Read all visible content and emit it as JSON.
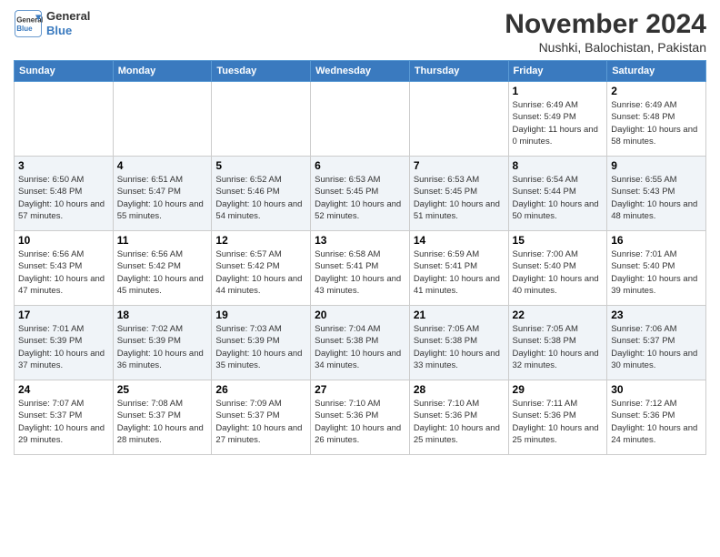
{
  "logo": {
    "line1": "General",
    "line2": "Blue"
  },
  "header": {
    "month": "November 2024",
    "location": "Nushki, Balochistan, Pakistan"
  },
  "weekdays": [
    "Sunday",
    "Monday",
    "Tuesday",
    "Wednesday",
    "Thursday",
    "Friday",
    "Saturday"
  ],
  "weeks": [
    [
      {
        "day": "",
        "info": ""
      },
      {
        "day": "",
        "info": ""
      },
      {
        "day": "",
        "info": ""
      },
      {
        "day": "",
        "info": ""
      },
      {
        "day": "",
        "info": ""
      },
      {
        "day": "1",
        "info": "Sunrise: 6:49 AM\nSunset: 5:49 PM\nDaylight: 11 hours and 0 minutes."
      },
      {
        "day": "2",
        "info": "Sunrise: 6:49 AM\nSunset: 5:48 PM\nDaylight: 10 hours and 58 minutes."
      }
    ],
    [
      {
        "day": "3",
        "info": "Sunrise: 6:50 AM\nSunset: 5:48 PM\nDaylight: 10 hours and 57 minutes."
      },
      {
        "day": "4",
        "info": "Sunrise: 6:51 AM\nSunset: 5:47 PM\nDaylight: 10 hours and 55 minutes."
      },
      {
        "day": "5",
        "info": "Sunrise: 6:52 AM\nSunset: 5:46 PM\nDaylight: 10 hours and 54 minutes."
      },
      {
        "day": "6",
        "info": "Sunrise: 6:53 AM\nSunset: 5:45 PM\nDaylight: 10 hours and 52 minutes."
      },
      {
        "day": "7",
        "info": "Sunrise: 6:53 AM\nSunset: 5:45 PM\nDaylight: 10 hours and 51 minutes."
      },
      {
        "day": "8",
        "info": "Sunrise: 6:54 AM\nSunset: 5:44 PM\nDaylight: 10 hours and 50 minutes."
      },
      {
        "day": "9",
        "info": "Sunrise: 6:55 AM\nSunset: 5:43 PM\nDaylight: 10 hours and 48 minutes."
      }
    ],
    [
      {
        "day": "10",
        "info": "Sunrise: 6:56 AM\nSunset: 5:43 PM\nDaylight: 10 hours and 47 minutes."
      },
      {
        "day": "11",
        "info": "Sunrise: 6:56 AM\nSunset: 5:42 PM\nDaylight: 10 hours and 45 minutes."
      },
      {
        "day": "12",
        "info": "Sunrise: 6:57 AM\nSunset: 5:42 PM\nDaylight: 10 hours and 44 minutes."
      },
      {
        "day": "13",
        "info": "Sunrise: 6:58 AM\nSunset: 5:41 PM\nDaylight: 10 hours and 43 minutes."
      },
      {
        "day": "14",
        "info": "Sunrise: 6:59 AM\nSunset: 5:41 PM\nDaylight: 10 hours and 41 minutes."
      },
      {
        "day": "15",
        "info": "Sunrise: 7:00 AM\nSunset: 5:40 PM\nDaylight: 10 hours and 40 minutes."
      },
      {
        "day": "16",
        "info": "Sunrise: 7:01 AM\nSunset: 5:40 PM\nDaylight: 10 hours and 39 minutes."
      }
    ],
    [
      {
        "day": "17",
        "info": "Sunrise: 7:01 AM\nSunset: 5:39 PM\nDaylight: 10 hours and 37 minutes."
      },
      {
        "day": "18",
        "info": "Sunrise: 7:02 AM\nSunset: 5:39 PM\nDaylight: 10 hours and 36 minutes."
      },
      {
        "day": "19",
        "info": "Sunrise: 7:03 AM\nSunset: 5:39 PM\nDaylight: 10 hours and 35 minutes."
      },
      {
        "day": "20",
        "info": "Sunrise: 7:04 AM\nSunset: 5:38 PM\nDaylight: 10 hours and 34 minutes."
      },
      {
        "day": "21",
        "info": "Sunrise: 7:05 AM\nSunset: 5:38 PM\nDaylight: 10 hours and 33 minutes."
      },
      {
        "day": "22",
        "info": "Sunrise: 7:05 AM\nSunset: 5:38 PM\nDaylight: 10 hours and 32 minutes."
      },
      {
        "day": "23",
        "info": "Sunrise: 7:06 AM\nSunset: 5:37 PM\nDaylight: 10 hours and 30 minutes."
      }
    ],
    [
      {
        "day": "24",
        "info": "Sunrise: 7:07 AM\nSunset: 5:37 PM\nDaylight: 10 hours and 29 minutes."
      },
      {
        "day": "25",
        "info": "Sunrise: 7:08 AM\nSunset: 5:37 PM\nDaylight: 10 hours and 28 minutes."
      },
      {
        "day": "26",
        "info": "Sunrise: 7:09 AM\nSunset: 5:37 PM\nDaylight: 10 hours and 27 minutes."
      },
      {
        "day": "27",
        "info": "Sunrise: 7:10 AM\nSunset: 5:36 PM\nDaylight: 10 hours and 26 minutes."
      },
      {
        "day": "28",
        "info": "Sunrise: 7:10 AM\nSunset: 5:36 PM\nDaylight: 10 hours and 25 minutes."
      },
      {
        "day": "29",
        "info": "Sunrise: 7:11 AM\nSunset: 5:36 PM\nDaylight: 10 hours and 25 minutes."
      },
      {
        "day": "30",
        "info": "Sunrise: 7:12 AM\nSunset: 5:36 PM\nDaylight: 10 hours and 24 minutes."
      }
    ]
  ]
}
